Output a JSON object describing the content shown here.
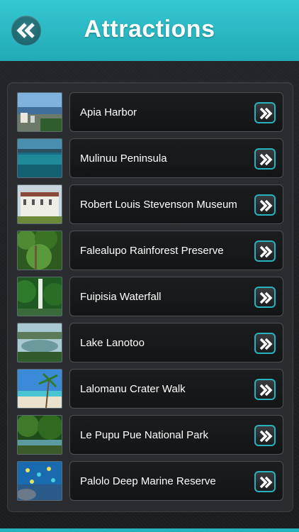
{
  "header": {
    "title": "Attractions"
  },
  "items": [
    {
      "label": "Apia Harbor",
      "thumb": "harbor-photo"
    },
    {
      "label": "Mulinuu Peninsula",
      "thumb": "peninsula-photo"
    },
    {
      "label": "Robert Louis Stevenson Museum",
      "thumb": "museum-photo"
    },
    {
      "label": "Falealupo Rainforest Preserve",
      "thumb": "rainforest-photo"
    },
    {
      "label": "Fuipisia Waterfall",
      "thumb": "waterfall-photo"
    },
    {
      "label": "Lake Lanotoo",
      "thumb": "lake-photo"
    },
    {
      "label": "Lalomanu Crater Walk",
      "thumb": "beach-photo"
    },
    {
      "label": "Le Pupu Pue National Park",
      "thumb": "park-photo"
    },
    {
      "label": "Palolo Deep Marine Reserve",
      "thumb": "reef-photo"
    }
  ],
  "colors": {
    "accent": "#26b3c0",
    "header": "#2ab8c3"
  }
}
